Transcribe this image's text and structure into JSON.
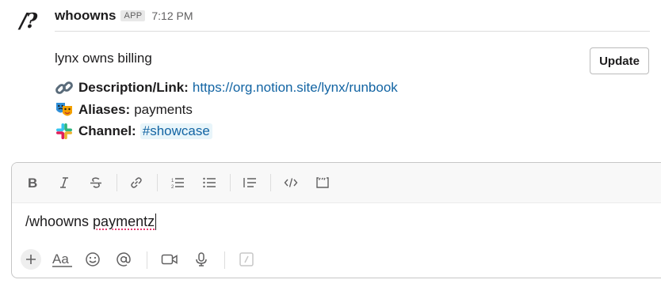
{
  "message": {
    "avatar_text": "/?",
    "sender": "whoowns",
    "badge": "APP",
    "timestamp": "7:12 PM",
    "body_text": "lynx owns billing",
    "update_button_label": "Update",
    "fields": [
      {
        "icon": "link-emoji",
        "label": "Description/Link:",
        "value": "https://org.notion.site/lynx/runbook"
      },
      {
        "icon": "performing-arts-emoji",
        "label": "Aliases:",
        "value": "payments"
      },
      {
        "icon": "slack-logo-icon",
        "label": "Channel:",
        "value": "#showcase"
      }
    ]
  },
  "composer": {
    "text_before": "/whoowns ",
    "misspelled_word": "paymentz",
    "formatting_tools": [
      "bold",
      "italic",
      "strikethrough",
      "link",
      "ordered-list",
      "bulleted-list",
      "blockquote",
      "code",
      "code-block"
    ],
    "bottom_tools": [
      "add",
      "formatting",
      "emoji",
      "mention",
      "video",
      "audio",
      "slash-command"
    ]
  },
  "colors": {
    "link": "#1264a3",
    "text": "#1d1c1d",
    "muted": "#616061",
    "channel_chip_bg": "#e8f5fa",
    "spellcheck": "#e01e5a"
  }
}
